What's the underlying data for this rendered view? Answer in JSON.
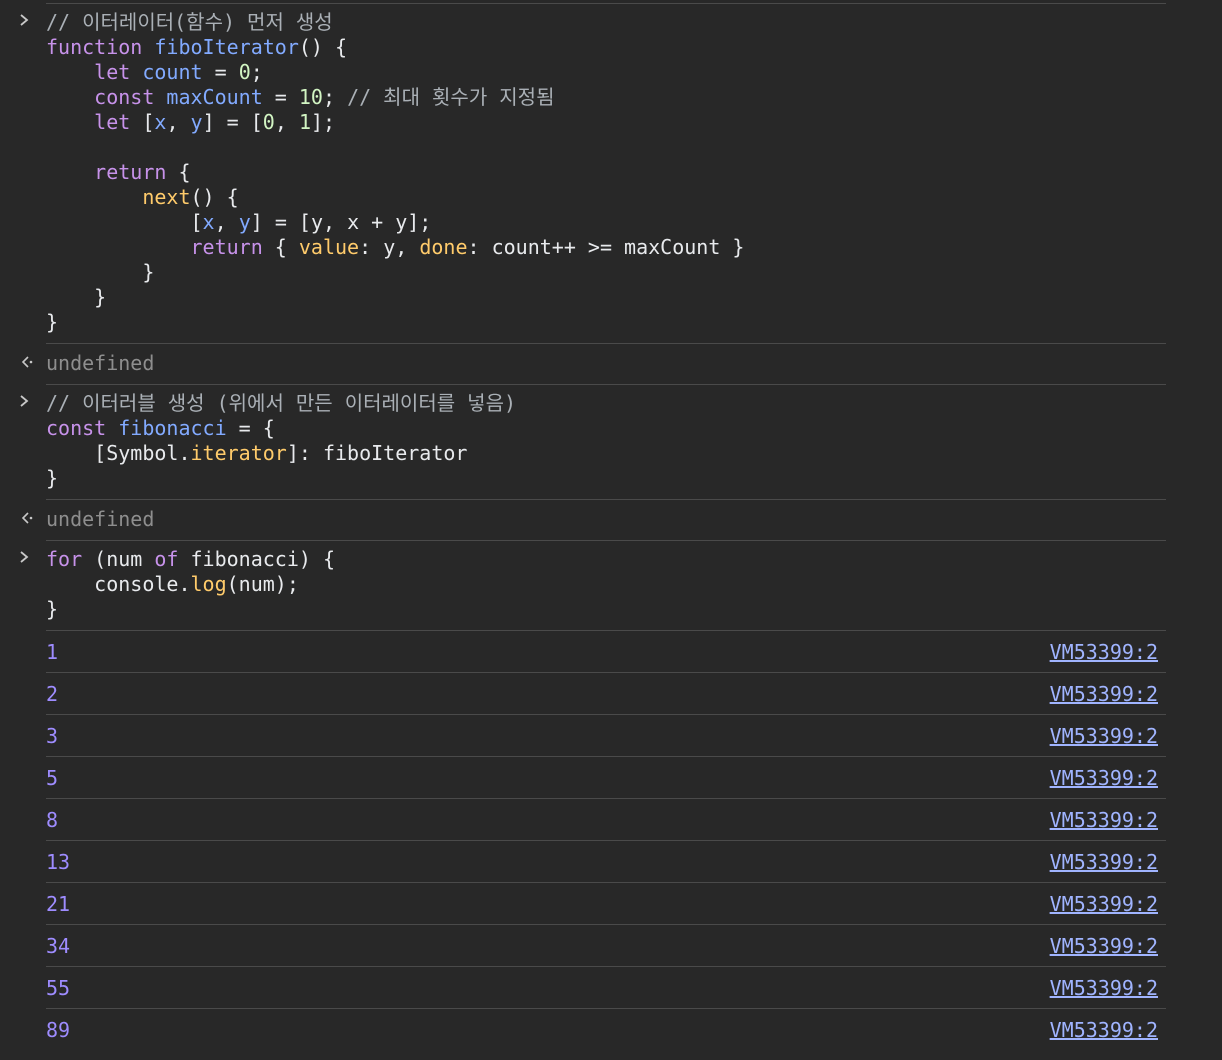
{
  "inputs": [
    {
      "lines": [
        [
          {
            "t": "// 이터레이터(함수) 먼저 생성",
            "c": "cm"
          }
        ],
        [
          {
            "t": "function ",
            "c": "kw"
          },
          {
            "t": "fiboIterator",
            "c": "fn"
          },
          {
            "t": "() {",
            "c": "plain"
          }
        ],
        [
          {
            "t": "    ",
            "c": "plain"
          },
          {
            "t": "let ",
            "c": "kw"
          },
          {
            "t": "count",
            "c": "var"
          },
          {
            "t": " = ",
            "c": "plain"
          },
          {
            "t": "0",
            "c": "num"
          },
          {
            "t": ";",
            "c": "plain"
          }
        ],
        [
          {
            "t": "    ",
            "c": "plain"
          },
          {
            "t": "const ",
            "c": "kw"
          },
          {
            "t": "maxCount",
            "c": "var"
          },
          {
            "t": " = ",
            "c": "plain"
          },
          {
            "t": "10",
            "c": "num"
          },
          {
            "t": "; ",
            "c": "plain"
          },
          {
            "t": "// 최대 횟수가 지정됨",
            "c": "cm"
          }
        ],
        [
          {
            "t": "    ",
            "c": "plain"
          },
          {
            "t": "let ",
            "c": "kw"
          },
          {
            "t": "[",
            "c": "plain"
          },
          {
            "t": "x",
            "c": "var"
          },
          {
            "t": ", ",
            "c": "plain"
          },
          {
            "t": "y",
            "c": "var"
          },
          {
            "t": "] = [",
            "c": "plain"
          },
          {
            "t": "0",
            "c": "num"
          },
          {
            "t": ", ",
            "c": "plain"
          },
          {
            "t": "1",
            "c": "num"
          },
          {
            "t": "];",
            "c": "plain"
          }
        ],
        [],
        [
          {
            "t": "    ",
            "c": "plain"
          },
          {
            "t": "return ",
            "c": "kw"
          },
          {
            "t": "{",
            "c": "plain"
          }
        ],
        [
          {
            "t": "        ",
            "c": "plain"
          },
          {
            "t": "next",
            "c": "prop"
          },
          {
            "t": "() {",
            "c": "plain"
          }
        ],
        [
          {
            "t": "            [",
            "c": "plain"
          },
          {
            "t": "x",
            "c": "var"
          },
          {
            "t": ", ",
            "c": "plain"
          },
          {
            "t": "y",
            "c": "var"
          },
          {
            "t": "] = [y, x + y];",
            "c": "plain"
          }
        ],
        [
          {
            "t": "            ",
            "c": "plain"
          },
          {
            "t": "return ",
            "c": "kw"
          },
          {
            "t": "{ ",
            "c": "plain"
          },
          {
            "t": "value",
            "c": "prop"
          },
          {
            "t": ": y, ",
            "c": "plain"
          },
          {
            "t": "done",
            "c": "prop"
          },
          {
            "t": ": count++ >= maxCount }",
            "c": "plain"
          }
        ],
        [
          {
            "t": "        }",
            "c": "plain"
          }
        ],
        [
          {
            "t": "    }",
            "c": "plain"
          }
        ],
        [
          {
            "t": "}",
            "c": "plain"
          }
        ]
      ],
      "result": "undefined"
    },
    {
      "lines": [
        [
          {
            "t": "// 이터러블 생성 (위에서 만든 이터레이터를 넣음)",
            "c": "cm"
          }
        ],
        [
          {
            "t": "const ",
            "c": "kw"
          },
          {
            "t": "fibonacci",
            "c": "var"
          },
          {
            "t": " = {",
            "c": "plain"
          }
        ],
        [
          {
            "t": "    [Symbol.",
            "c": "plain"
          },
          {
            "t": "iterator",
            "c": "prop"
          },
          {
            "t": "]: fiboIterator",
            "c": "plain"
          }
        ],
        [
          {
            "t": "}",
            "c": "plain"
          }
        ]
      ],
      "result": "undefined"
    },
    {
      "lines": [
        [
          {
            "t": "for ",
            "c": "kw"
          },
          {
            "t": "(num ",
            "c": "plain"
          },
          {
            "t": "of ",
            "c": "kw"
          },
          {
            "t": "fibonacci) {",
            "c": "plain"
          }
        ],
        [
          {
            "t": "    console.",
            "c": "plain"
          },
          {
            "t": "log",
            "c": "prop"
          },
          {
            "t": "(num);",
            "c": "plain"
          }
        ],
        [
          {
            "t": "}",
            "c": "plain"
          }
        ]
      ],
      "result": null
    }
  ],
  "logs": [
    {
      "value": "1",
      "source": "VM53399:2"
    },
    {
      "value": "2",
      "source": "VM53399:2"
    },
    {
      "value": "3",
      "source": "VM53399:2"
    },
    {
      "value": "5",
      "source": "VM53399:2"
    },
    {
      "value": "8",
      "source": "VM53399:2"
    },
    {
      "value": "13",
      "source": "VM53399:2"
    },
    {
      "value": "21",
      "source": "VM53399:2"
    },
    {
      "value": "34",
      "source": "VM53399:2"
    },
    {
      "value": "55",
      "source": "VM53399:2"
    },
    {
      "value": "89",
      "source": "VM53399:2"
    }
  ],
  "icons": {
    "input_prompt": "chevron-right-icon",
    "result_prompt": "return-arrow-icon"
  },
  "colors": {
    "background": "#282828",
    "keyword": "#c792ea",
    "identifier": "#82aaff",
    "property": "#ffcb6b",
    "number": "#d2f5c3",
    "comment": "#aab0b6",
    "log_number": "#9e8cff",
    "link": "#a0b4ff"
  }
}
